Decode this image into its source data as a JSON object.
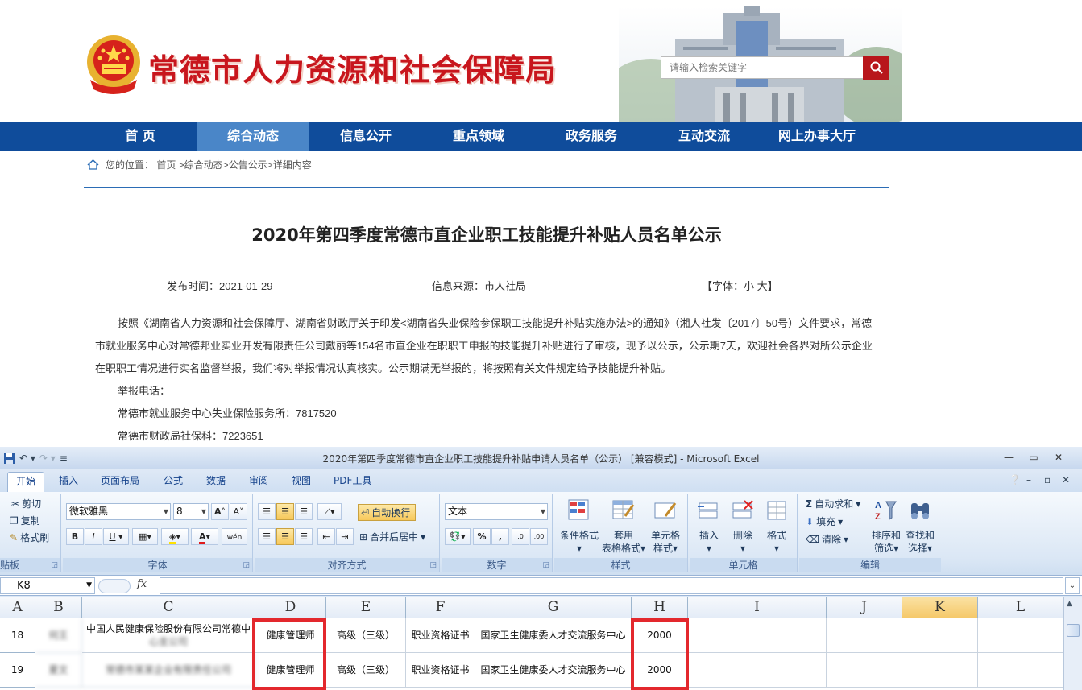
{
  "site": {
    "title": "常德市人力资源和社会保障局",
    "search_placeholder": "请输入检索关键字",
    "accent": "#c8161d",
    "nav_color": "#0f4c9b"
  },
  "nav": [
    "首 页",
    "综合动态",
    "信息公开",
    "重点领域",
    "政务服务",
    "互动交流",
    "网上办事大厅"
  ],
  "breadcrumb": "您的位置： 首页 >综合动态>公告公示>详细内容",
  "article": {
    "title": "2020年第四季度常德市直企业职工技能提升补贴人员名单公示",
    "publish_time": "发布时间：2021-01-29",
    "source": "信息来源：市人社局",
    "font_label": "【字体：",
    "font_small": "小",
    "font_large": "大",
    "font_close": "】",
    "paragraph": "按照《湖南省人力资源和社会保障厅、湖南省财政厅关于印发<湖南省失业保险参保职工技能提升补贴实施办法>的通知》（湘人社发〔2017〕50号）文件要求，常德市就业服务中心对常德邦业实业开发有限责任公司戴丽等154名市直企业在职职工申报的技能提升补贴进行了审核，现予以公示，公示期7天，欢迎社会各界对所公示企业在职职工情况进行实名监督举报，我们将对举报情况认真核实。公示期满无举报的，将按照有关文件规定给予技能提升补贴。",
    "report_label": "举报电话：",
    "contact_1": "常德市就业服务中心失业保险服务所：7817520",
    "contact_2": "常德市财政局社保科：7223651"
  },
  "excel": {
    "window_title": "2020年第四季度常德市直企业职工技能提升补贴申请人员名单（公示） [兼容模式] - Microsoft Excel",
    "tabs": [
      "开始",
      "插入",
      "页面布局",
      "公式",
      "数据",
      "审阅",
      "视图",
      "PDF工具"
    ],
    "clipboard": {
      "cut": "剪切",
      "copy": "复制",
      "painter": "格式刷",
      "label": "剪贴板"
    },
    "font": {
      "name": "微软雅黑",
      "size": "8",
      "bold": "B",
      "italic": "I",
      "underline": "U",
      "grow": "A",
      "shrink": "A",
      "phonetic": "wén",
      "label": "字体"
    },
    "alignment": {
      "wrap": "自动换行",
      "merge": "合并后居中",
      "label": "对齐方式"
    },
    "number": {
      "format": "文本",
      "percent": "%",
      "comma": ",",
      "inc_dec": ".0",
      "dec_dec": ".00",
      "label": "数字"
    },
    "styles": {
      "conditional": [
        "条件格式"
      ],
      "table_l1": "套用",
      "table_l2": "表格格式",
      "cell_l1": "单元格",
      "cell_l2": "样式",
      "label": "样式"
    },
    "cells": {
      "insert": "插入",
      "delete": "删除",
      "format": "格式",
      "label": "单元格"
    },
    "editing": {
      "autosum": "自动求和",
      "fill": "填充",
      "clear": "清除",
      "sort_l1": "排序和",
      "sort_l2": "筛选",
      "find_l1": "查找和",
      "find_l2": "选择",
      "label": "编辑"
    },
    "name_box": "K8",
    "fx": "fx",
    "columns": [
      "A",
      "B",
      "C",
      "D",
      "E",
      "F",
      "G",
      "H",
      "I",
      "J",
      "K",
      "L"
    ],
    "rows": [
      {
        "row_no": "18",
        "name": "何王",
        "company_l1": "中国人民健康保险股份有限公司常德中",
        "company_l2": "心支公司",
        "occupation": "健康管理师",
        "level": "高级（三级）",
        "cert": "职业资格证书",
        "issuer": "国家卫生健康委人才交流服务中心",
        "amount": "2000"
      },
      {
        "row_no": "19",
        "name": "夏文",
        "company_l1": "常德市某某企业有限责任公司",
        "company_l2": "",
        "occupation": "健康管理师",
        "level": "高级（三级）",
        "cert": "职业资格证书",
        "issuer": "国家卫生健康委人才交流服务中心",
        "amount": "2000"
      }
    ]
  }
}
